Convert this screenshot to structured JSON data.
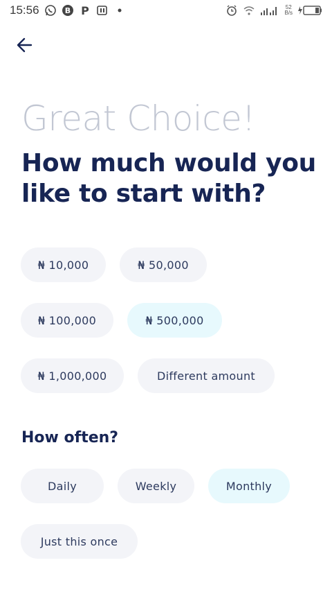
{
  "status_bar": {
    "time": "15:56",
    "net_speed_value": "52",
    "net_speed_unit": "B/s"
  },
  "header": {
    "back_icon": "arrow-left-icon"
  },
  "main": {
    "headline": "Great Choice!",
    "question": "How much would you like to start with?",
    "amounts": [
      {
        "label": "₦ 10,000",
        "selected": false
      },
      {
        "label": "₦ 50,000",
        "selected": false
      },
      {
        "label": "₦ 100,000",
        "selected": false
      },
      {
        "label": "₦ 500,000",
        "selected": true
      },
      {
        "label": "₦ 1,000,000",
        "selected": false
      },
      {
        "label": "Different amount",
        "selected": false
      }
    ],
    "frequency_title": "How often?",
    "frequencies": [
      {
        "label": "Daily",
        "selected": false
      },
      {
        "label": "Weekly",
        "selected": false
      },
      {
        "label": "Monthly",
        "selected": true
      },
      {
        "label": "Just this once",
        "selected": false
      }
    ]
  },
  "colors": {
    "primary_text": "#172554",
    "headline_text": "#c2c7d3",
    "chip_bg": "#f3f4f8",
    "chip_selected_bg": "#e7f9fd"
  }
}
